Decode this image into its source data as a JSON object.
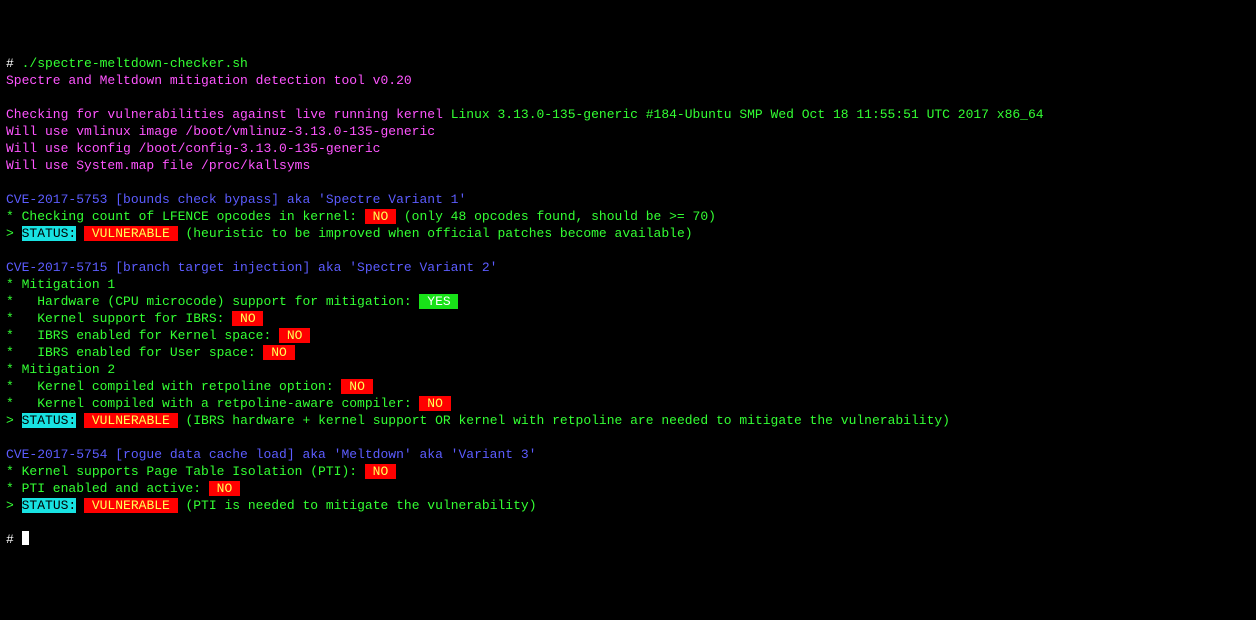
{
  "prompt1": "# ",
  "cmd": "./spectre-meltdown-checker.sh",
  "title": "Spectre and Meltdown mitigation detection tool v0.20",
  "check_prefix": "Checking for vulnerabilities against live running kernel ",
  "kernel": "Linux 3.13.0-135-generic #184-Ubuntu SMP Wed Oct 18 11:55:51 UTC 2017 x86_64",
  "use1": "Will use vmlinux image /boot/vmlinuz-3.13.0-135-generic",
  "use2": "Will use kconfig /boot/config-3.13.0-135-generic",
  "use3": "Will use System.map file /proc/kallsyms",
  "cve1": {
    "header": "CVE-2017-5753 [bounds check bypass] aka 'Spectre Variant 1'",
    "l1a": "* Checking count of LFENCE opcodes in kernel: ",
    "l1b": " NO ",
    "l1c": " (only 48 opcodes found, should be >= 70)",
    "st_a": "> ",
    "st_b": "STATUS:",
    "st_c": " VULNERABLE ",
    "st_d": " (heuristic to be improved when official patches become available)"
  },
  "cve2": {
    "header": "CVE-2017-5715 [branch target injection] aka 'Spectre Variant 2'",
    "m1": "* Mitigation 1",
    "m1a_l": "*   Hardware (CPU microcode) support for mitigation: ",
    "m1a_v": " YES ",
    "m1b_l": "*   Kernel support for IBRS: ",
    "m1b_v": " NO ",
    "m1c_l": "*   IBRS enabled for Kernel space: ",
    "m1c_v": " NO ",
    "m1d_l": "*   IBRS enabled for User space: ",
    "m1d_v": " NO ",
    "m2": "* Mitigation 2",
    "m2a_l": "*   Kernel compiled with retpoline option: ",
    "m2a_v": " NO ",
    "m2b_l": "*   Kernel compiled with a retpoline-aware compiler: ",
    "m2b_v": " NO ",
    "st_a": "> ",
    "st_b": "STATUS:",
    "st_c": " VULNERABLE ",
    "st_d": " (IBRS hardware + kernel support OR kernel with retpoline are needed to mitigate the vulnerability)"
  },
  "cve3": {
    "header": "CVE-2017-5754 [rogue data cache load] aka 'Meltdown' aka 'Variant 3'",
    "l1a": "* Kernel supports Page Table Isolation (PTI): ",
    "l1b": " NO ",
    "l2a": "* PTI enabled and active: ",
    "l2b": " NO ",
    "st_a": "> ",
    "st_b": "STATUS:",
    "st_c": " VULNERABLE ",
    "st_d": " (PTI is needed to mitigate the vulnerability)"
  },
  "prompt2": "# "
}
